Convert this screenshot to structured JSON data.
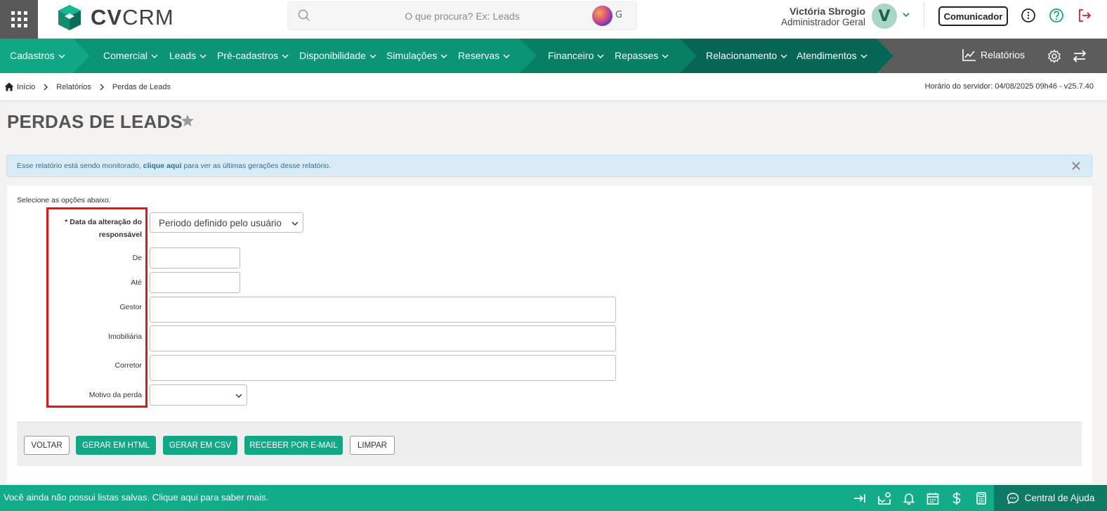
{
  "header": {
    "logo_text_bold": "CV",
    "logo_text_light": "CRM",
    "search_placeholder": "O que procura? Ex: Leads",
    "ai_letter": "G",
    "user_name": "Victória Sbrogio",
    "user_role": "Administrador Geral",
    "avatar_letter": "V",
    "comunicador_label": "Comunicador"
  },
  "nav": {
    "items": [
      "Cadastros",
      "Comercial",
      "Leads",
      "Pré-cadastros",
      "Disponibilidade",
      "Simulações",
      "Reservas",
      "Financeiro",
      "Repasses",
      "Relacionamento",
      "Atendimentos"
    ],
    "relatorios": "Relatórios",
    "colors": {
      "seg1": "#10a884",
      "seg2": "#0b9575",
      "seg3": "#087e63",
      "seg4": "#066654"
    }
  },
  "breadcrumb": {
    "items": [
      "Início",
      "Relatórios",
      "Perdas de Leads"
    ],
    "server_time": "Horário do servidor: 04/08/2025 09h46 - v25.7.40"
  },
  "page": {
    "title": "PERDAS DE LEADS"
  },
  "alert": {
    "text_before": "Esse relatório está sendo monitorado, ",
    "link": "clique aqui",
    "text_after": " para ver as últimas gerações desse relatório."
  },
  "form": {
    "hint": "Selecione as opções abaixo.",
    "date_label_line1": "* Data da alteração do",
    "date_label_line2": "responsável",
    "date_select_value": "Periodo definido pelo usuário",
    "de_label": "De",
    "de_value": "",
    "ate_label": "Até",
    "ate_value": "",
    "gestor_label": "Gestor",
    "imobiliaria_label": "Imobiliária",
    "corretor_label": "Corretor",
    "motivo_label": "Motivo da perda",
    "motivo_value": ""
  },
  "actions": {
    "voltar": "VOLTAR",
    "gerar_html": "GERAR EM HTML",
    "gerar_csv": "GERAR EM CSV",
    "receber_email": "RECEBER POR E-MAIL",
    "limpar": "LIMPAR"
  },
  "bottom": {
    "message": "Você ainda não possui listas salvas. Clique aqui para saber mais.",
    "help": "Central de Ajuda"
  }
}
